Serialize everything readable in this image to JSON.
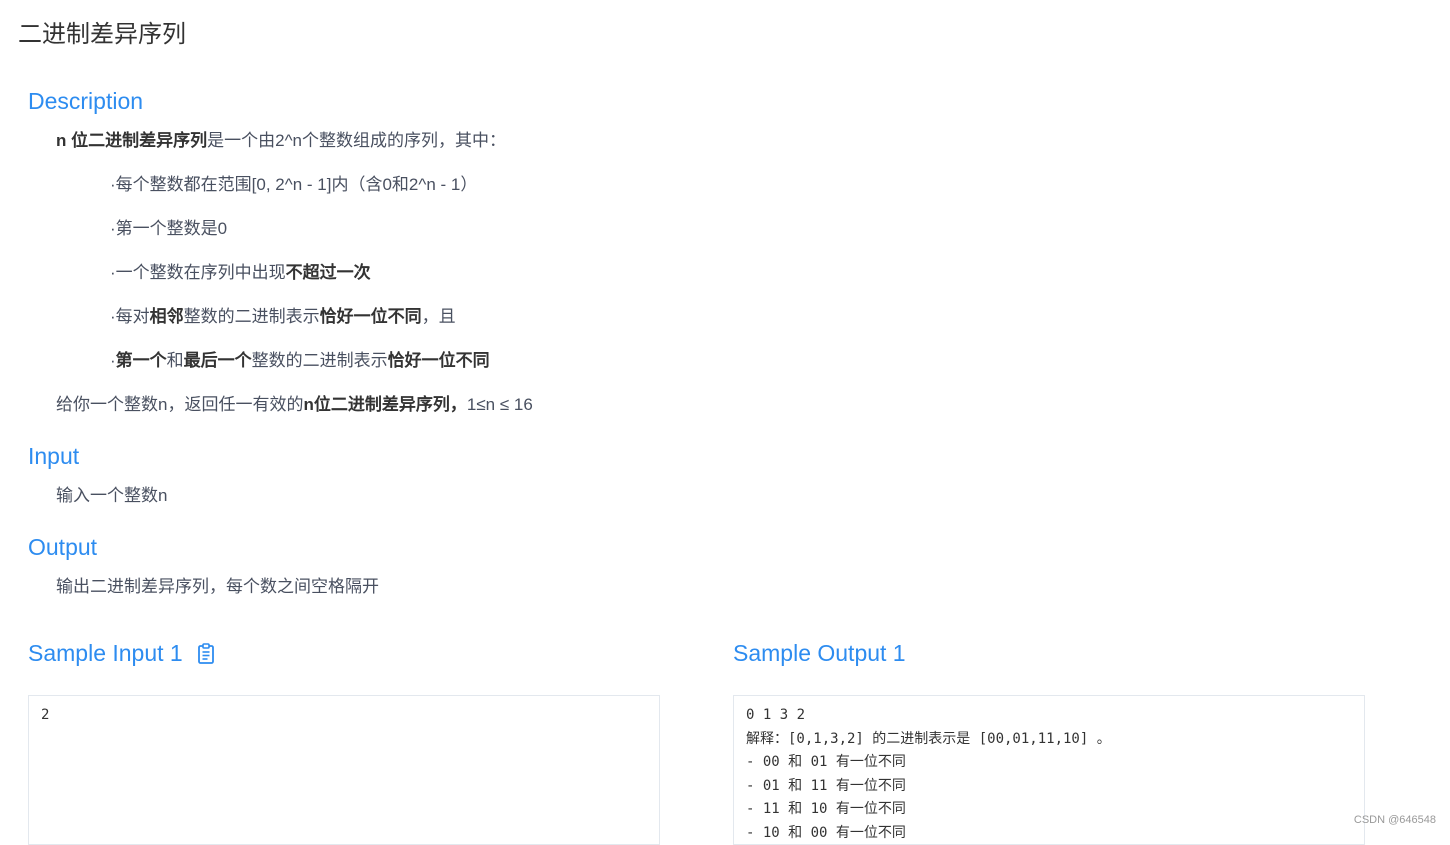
{
  "page": {
    "title": "二进制差异序列"
  },
  "description": {
    "heading": "Description",
    "intro": {
      "bold": "n 位二进制差异序列",
      "rest": "是一个由2^n个整数组成的序列，其中："
    },
    "bullets": [
      {
        "parts": [
          {
            "t": "·每个整数都在范围[0, 2^n - 1]内（含0和2^n -  1）",
            "b": false
          }
        ]
      },
      {
        "parts": [
          {
            "t": "·第一个整数是0",
            "b": false
          }
        ]
      },
      {
        "parts": [
          {
            "t": "·一个整数在序列中出现",
            "b": false
          },
          {
            "t": "不超过一次",
            "b": true
          }
        ]
      },
      {
        "parts": [
          {
            "t": "·每对",
            "b": false
          },
          {
            "t": "相邻",
            "b": true
          },
          {
            "t": "整数的二进制表示",
            "b": false
          },
          {
            "t": "恰好一位不同",
            "b": true
          },
          {
            "t": "，且",
            "b": false
          }
        ]
      },
      {
        "parts": [
          {
            "t": "·",
            "b": false
          },
          {
            "t": "第一个",
            "b": true
          },
          {
            "t": "和",
            "b": false
          },
          {
            "t": "最后一个",
            "b": true
          },
          {
            "t": "整数的二进制表示",
            "b": false
          },
          {
            "t": "恰好一位不同",
            "b": true
          }
        ]
      }
    ],
    "closing": {
      "pre": "给你一个整数n，返回任一有效的",
      "bold": "n位二进制差异序列，",
      "post": "1≤n ≤ 16"
    }
  },
  "input": {
    "heading": "Input",
    "text": "输入一个整数n"
  },
  "output": {
    "heading": "Output",
    "text": "输出二进制差异序列，每个数之间空格隔开"
  },
  "sample_input": {
    "heading": "Sample Input 1",
    "content": "2",
    "copy_icon": "clipboard-icon"
  },
  "sample_output": {
    "heading": "Sample Output 1",
    "content": "0 1 3 2\n解释：[0,1,3,2] 的二进制表示是 [00,01,11,10] 。\n- 00 和 01 有一位不同\n- 01 和 11 有一位不同\n- 11 和 10 有一位不同\n- 10 和 00 有一位不同"
  },
  "watermark": "CSDN @646548",
  "colors": {
    "accent": "#2d8cf0",
    "text": "#495060",
    "border": "#e3e8ee"
  }
}
